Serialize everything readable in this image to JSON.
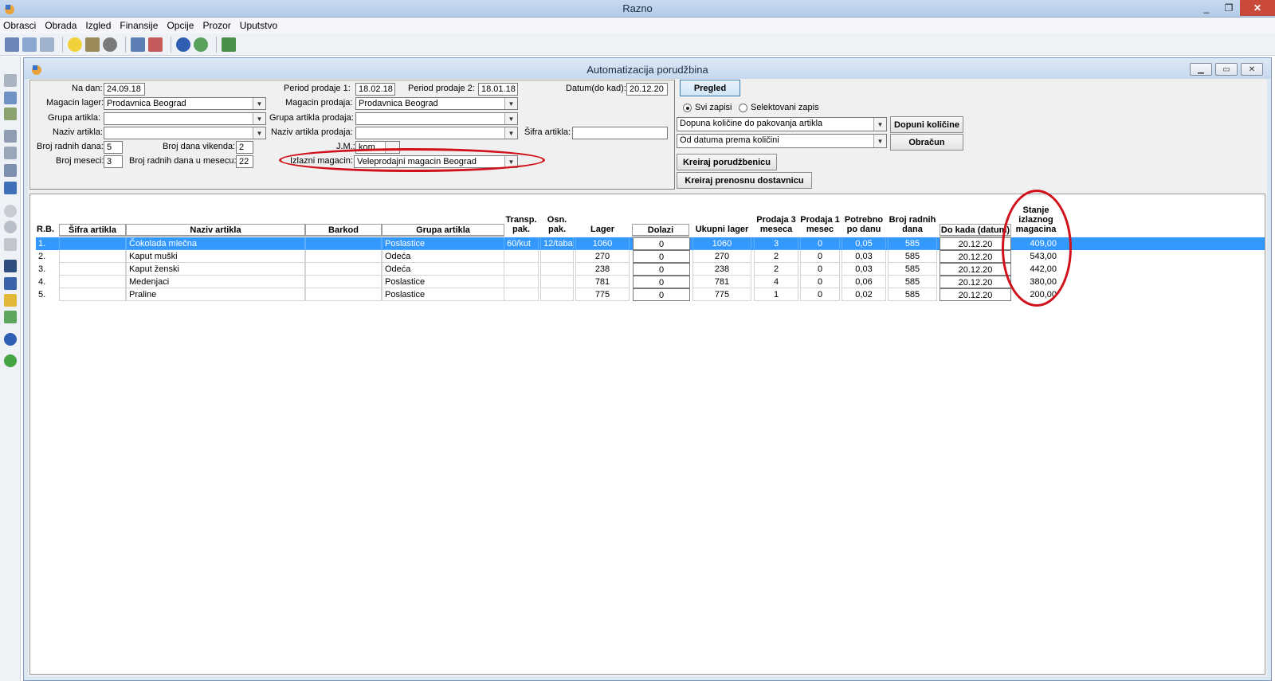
{
  "app": {
    "title": "Razno",
    "window_buttons": [
      "_",
      "❐",
      "✕"
    ]
  },
  "menu": [
    "Obrasci",
    "Obrada",
    "Izgled",
    "Finansije",
    "Opcije",
    "Prozor",
    "Uputstvo"
  ],
  "child": {
    "title": "Automatizacija porudžbina"
  },
  "filters": {
    "na_dan_label": "Na dan:",
    "na_dan": "24.09.18",
    "period1_label": "Period prodaje 1:",
    "period1": "18.02.18",
    "period2_label": "Period prodaje 2:",
    "period2": "18.01.18",
    "datum_label": "Datum(do kad):",
    "datum": "20.12.20",
    "magacin_lager_label": "Magacin lager:",
    "magacin_lager": "Prodavnica Beograd",
    "magacin_prodaja_label": "Magacin prodaja:",
    "magacin_prodaja": "Prodavnica Beograd",
    "grupa_label": "Grupa artikla:",
    "grupa": "",
    "grupa_prodaja_label": "Grupa artikla prodaja:",
    "grupa_prodaja": "",
    "naziv_label": "Naziv artikla:",
    "naziv": "",
    "naziv_prodaja_label": "Naziv artikla prodaja:",
    "naziv_prodaja": "",
    "sifra_label": "Šifra artikla:",
    "sifra": "",
    "radnih_dana_label": "Broj radnih dana:",
    "radnih_dana": "5",
    "vikenda_label": "Broj dana vikenda:",
    "vikenda": "2",
    "jm_label": "J.M.:",
    "jm": "kom",
    "meseci_label": "Broj meseci:",
    "meseci": "3",
    "radnih_mesec_label": "Broj radnih dana u mesecu:",
    "radnih_mesec": "22",
    "izlazni_label": "Izlazni magacin:",
    "izlazni": "Veleprodajni magacin Beograd"
  },
  "controls": {
    "pregled": "Pregled",
    "radio_all": "Svi zapisi",
    "radio_sel": "Selektovani zapis",
    "combo1": "Dopuna količine do pakovanja artikla",
    "combo2": "Od datuma prema količini",
    "dopuni": "Dopuni količine",
    "obracun": "Obračun",
    "kreiraj_por": "Kreiraj porudžbenicu",
    "kreiraj_pren": "Kreiraj prenosnu dostavnicu"
  },
  "columns": {
    "rb": "R.B.",
    "sifra": "Šifra artikla",
    "naziv": "Naziv artikla",
    "barkod": "Barkod",
    "grupa": "Grupa artikla",
    "transp": "Transp. pak.",
    "osn": "Osn. pak.",
    "lager": "Lager",
    "dolazi": "Dolazi",
    "ukupni": "Ukupni lager",
    "prodaja3": "Prodaja 3 meseca",
    "prodaja1": "Prodaja 1 mesec",
    "potrebno": "Potrebno po danu",
    "brojrad": "Broj radnih dana",
    "dokada": "Do kada (datum)",
    "stanje": "Stanje izlaznog magacina"
  },
  "rows": [
    {
      "rb": "1.",
      "sifra": "",
      "naziv": "Čokolada mlečna",
      "barkod": "",
      "grupa": "Poslastice",
      "transp": "60/kut",
      "osn": "12/tabak",
      "lager": "1060",
      "dolazi": "0",
      "ukupni": "1060",
      "prodaja3": "3",
      "prodaja1": "0",
      "potrebno": "0,05",
      "brojrad": "585",
      "dokada": "20.12.20",
      "stanje": "409,00"
    },
    {
      "rb": "2.",
      "sifra": "",
      "naziv": "Kaput muški",
      "barkod": "",
      "grupa": "Odeća",
      "transp": "",
      "osn": "",
      "lager": "270",
      "dolazi": "0",
      "ukupni": "270",
      "prodaja3": "2",
      "prodaja1": "0",
      "potrebno": "0,03",
      "brojrad": "585",
      "dokada": "20.12.20",
      "stanje": "543,00"
    },
    {
      "rb": "3.",
      "sifra": "",
      "naziv": "Kaput ženski",
      "barkod": "",
      "grupa": "Odeća",
      "transp": "",
      "osn": "",
      "lager": "238",
      "dolazi": "0",
      "ukupni": "238",
      "prodaja3": "2",
      "prodaja1": "0",
      "potrebno": "0,03",
      "brojrad": "585",
      "dokada": "20.12.20",
      "stanje": "442,00"
    },
    {
      "rb": "4.",
      "sifra": "",
      "naziv": "Medenjaci",
      "barkod": "",
      "grupa": "Poslastice",
      "transp": "",
      "osn": "",
      "lager": "781",
      "dolazi": "0",
      "ukupni": "781",
      "prodaja3": "4",
      "prodaja1": "0",
      "potrebno": "0,06",
      "brojrad": "585",
      "dokada": "20.12.20",
      "stanje": "380,00"
    },
    {
      "rb": "5.",
      "sifra": "",
      "naziv": "Praline",
      "barkod": "",
      "grupa": "Poslastice",
      "transp": "",
      "osn": "",
      "lager": "775",
      "dolazi": "0",
      "ukupni": "775",
      "prodaja3": "1",
      "prodaja1": "0",
      "potrebno": "0,02",
      "brojrad": "585",
      "dokada": "20.12.20",
      "stanje": "200,00"
    }
  ],
  "colors": {
    "selection": "#3399ff",
    "annotation": "#d0101a"
  }
}
